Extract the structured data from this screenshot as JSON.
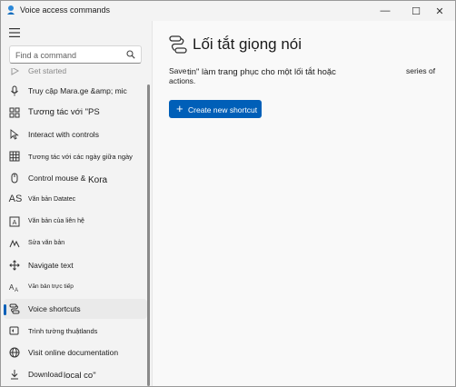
{
  "window": {
    "title": "Voice access commands",
    "controls": {
      "minimize": "—",
      "maximize": "☐",
      "close": "✕"
    }
  },
  "sidebar": {
    "search": {
      "placeholder": "Find a command"
    },
    "items": [
      {
        "label": "Get started",
        "icon": "play-icon"
      },
      {
        "label": "Truy cập Mara.ge &amp; mic",
        "icon": "microphone-icon"
      },
      {
        "label": "Tương tác với \"PS",
        "icon": "apps-icon"
      },
      {
        "label": "Interact with controls",
        "icon": "cursor-icon"
      },
      {
        "label": "Tương tác với các ngày giữa ngày",
        "icon": "grid-icon"
      },
      {
        "label": "Control mouse &",
        "label_extra": "Kora",
        "icon": "mouse-icon"
      },
      {
        "label": "Văn bản Datatec",
        "icon": "text-dictation-icon",
        "glyph": "AS"
      },
      {
        "label": "Văn bản của liên hệ",
        "icon": "text-box-icon"
      },
      {
        "label": "Sửa văn bản",
        "icon": "handwriting-icon"
      },
      {
        "label": "Navigate text",
        "icon": "move-icon"
      },
      {
        "label": "Văn bản trực tiếp",
        "icon": "text-format-icon"
      },
      {
        "label": "Voice shortcuts",
        "icon": "shortcuts-icon",
        "active": true
      },
      {
        "label": "Trình tường thuậtlands",
        "icon": "narrator-icon"
      },
      {
        "label": "Visit online documentation",
        "icon": "globe-icon"
      },
      {
        "label": "Download",
        "label_extra": "local co\"",
        "icon": "download-icon"
      }
    ]
  },
  "main": {
    "title": "Lối tắt giọng nói",
    "description": {
      "part1": "Save",
      "part2": "tin\" làm trang phục cho một lối tắt hoặc",
      "part3": "series of",
      "part4": "actions."
    },
    "create_button": {
      "label": "Create new shortcut",
      "icon": "plus-icon"
    }
  },
  "colors": {
    "accent": "#005fb8",
    "sidebar_bg": "#f3f3f3",
    "content_bg": "#f9f9f9"
  }
}
